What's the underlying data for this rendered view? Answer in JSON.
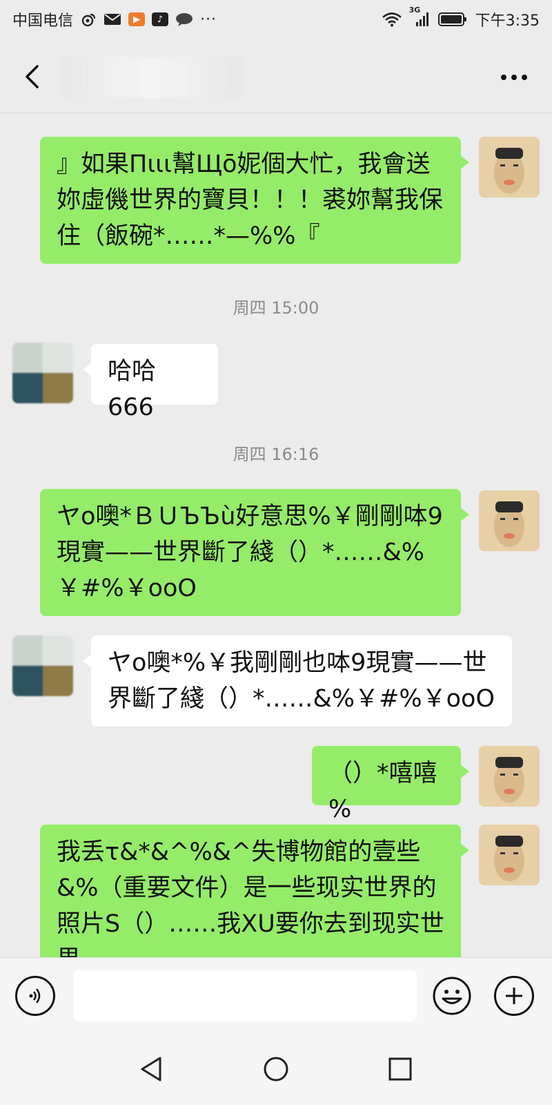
{
  "status_bar": {
    "carrier": "中国电信",
    "network": "3G",
    "time": "下午3:35"
  },
  "header": {
    "title": "",
    "back_icon": "back-arrow-icon",
    "more_icon": "more-dots-icon"
  },
  "messages": [
    {
      "sender": "self",
      "text": "』如果Πιιι幫Щō妮個大忙，我會送妳虛僟世界的寶貝！！！裘妳幫我保住（飯碗*……*—%%『"
    },
    {
      "type": "timestamp",
      "text": "周四 15:00"
    },
    {
      "sender": "other",
      "text": "哈哈 666"
    },
    {
      "type": "timestamp",
      "text": "周四 16:16"
    },
    {
      "sender": "self",
      "text": "ヤo噢*ＢＵЪЪù好意思%￥剛剛呠9現實——世界斷了綫（）*……&%￥#%￥ooO"
    },
    {
      "sender": "other",
      "text": "ヤo噢*%￥我剛剛也呠9現實——世界斷了綫（）*……&%￥#%￥ooO"
    },
    {
      "sender": "self",
      "text": "（）*嘻嘻 %"
    },
    {
      "sender": "self",
      "text": "我丢τ&*&^%&^失博物館的壹些&%（重要文件）是一些现实世界的照片S（）……我XU要你去到现实世界"
    }
  ],
  "input_bar": {
    "placeholder": "",
    "voice_icon": "voice-icon",
    "emoji_icon": "emoji-icon",
    "plus_icon": "plus-icon"
  },
  "nav_bar": {
    "back_icon": "nav-back-icon",
    "home_icon": "nav-home-icon",
    "recent_icon": "nav-recent-icon"
  },
  "colors": {
    "self_bubble": "#95ec69",
    "other_bubble": "#ffffff",
    "background": "#ececec",
    "timestamp": "#8a8a8a"
  }
}
